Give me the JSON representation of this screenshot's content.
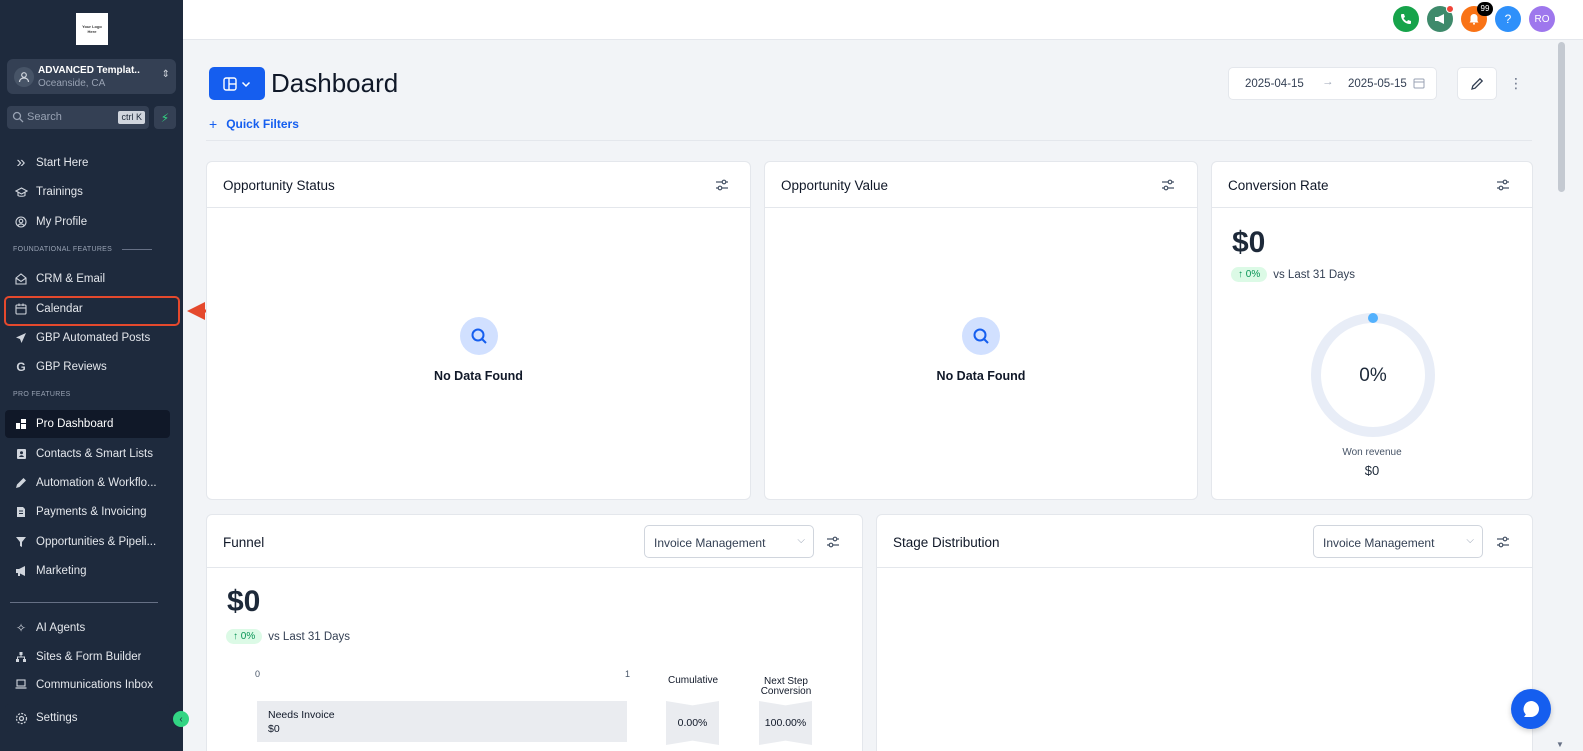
{
  "sidebar": {
    "logo_text": [
      "Your Logo",
      "Here"
    ],
    "account": {
      "name": "ADVANCED Templat..",
      "location": "Oceanside, CA"
    },
    "search": {
      "placeholder": "Search",
      "shortcut": "ctrl K"
    },
    "items_top": [
      {
        "label": "Start Here",
        "icon": "chevrons-right-icon"
      },
      {
        "label": "Trainings",
        "icon": "graduation-cap-icon"
      },
      {
        "label": "My Profile",
        "icon": "user-circle-icon"
      }
    ],
    "section_foundational": "FOUNDATIONAL FEATURES",
    "items_foundational": [
      {
        "label": "CRM & Email",
        "icon": "mail-open-icon"
      },
      {
        "label": "Calendar",
        "icon": "calendar-icon"
      },
      {
        "label": "GBP Automated Posts",
        "icon": "send-icon"
      },
      {
        "label": "GBP Reviews",
        "icon": "google-g-icon"
      }
    ],
    "section_pro": "PRO FEATURES",
    "items_pro": [
      {
        "label": "Pro Dashboard",
        "icon": "dashboard-icon",
        "active": true
      },
      {
        "label": "Contacts & Smart Lists",
        "icon": "contact-book-icon"
      },
      {
        "label": "Automation & Workflo...",
        "icon": "pencil-icon"
      },
      {
        "label": "Payments & Invoicing",
        "icon": "invoice-icon"
      },
      {
        "label": "Opportunities & Pipeli...",
        "icon": "filter-icon"
      },
      {
        "label": "Marketing",
        "icon": "megaphone-icon"
      }
    ],
    "items_bottom": [
      {
        "label": "AI Agents",
        "icon": "sparkles-icon"
      },
      {
        "label": "Sites & Form Builder",
        "icon": "sitemap-icon"
      },
      {
        "label": "Communications Inbox",
        "icon": "laptop-icon"
      }
    ],
    "settings_label": "Settings"
  },
  "topbar": {
    "phone_color": "#16a34a",
    "megaphone_color": "#3e8a6b",
    "notifications_count": "99",
    "help_label": "?",
    "user_initials": "RO"
  },
  "header": {
    "title": "Dashboard",
    "quick_filters": "Quick Filters",
    "date_start": "2025-04-15",
    "date_end": "2025-05-15"
  },
  "cards": {
    "opportunity_status": {
      "title": "Opportunity Status",
      "empty": "No Data Found"
    },
    "opportunity_value": {
      "title": "Opportunity Value",
      "empty": "No Data Found"
    },
    "conversion_rate": {
      "title": "Conversion Rate",
      "value": "$0",
      "trend": "0%",
      "trend_label": "vs Last 31 Days",
      "gauge_text": "0%",
      "gauge_fraction": 0,
      "won_label": "Won revenue",
      "won_value": "$0"
    },
    "funnel": {
      "title": "Funnel",
      "select": "Invoice Management",
      "value": "$0",
      "trend": "0%",
      "trend_label": "vs Last 31 Days",
      "axis_min": "0",
      "axis_max": "1",
      "col_cumulative": "Cumulative",
      "col_next_1": "Next Step",
      "col_next_2": "Conversion",
      "rows": [
        {
          "name": "Needs Invoice",
          "value": "$0",
          "cumulative": "0.00%",
          "next": "100.00%"
        }
      ]
    },
    "stage_distribution": {
      "title": "Stage Distribution",
      "select": "Invoice Management"
    }
  }
}
